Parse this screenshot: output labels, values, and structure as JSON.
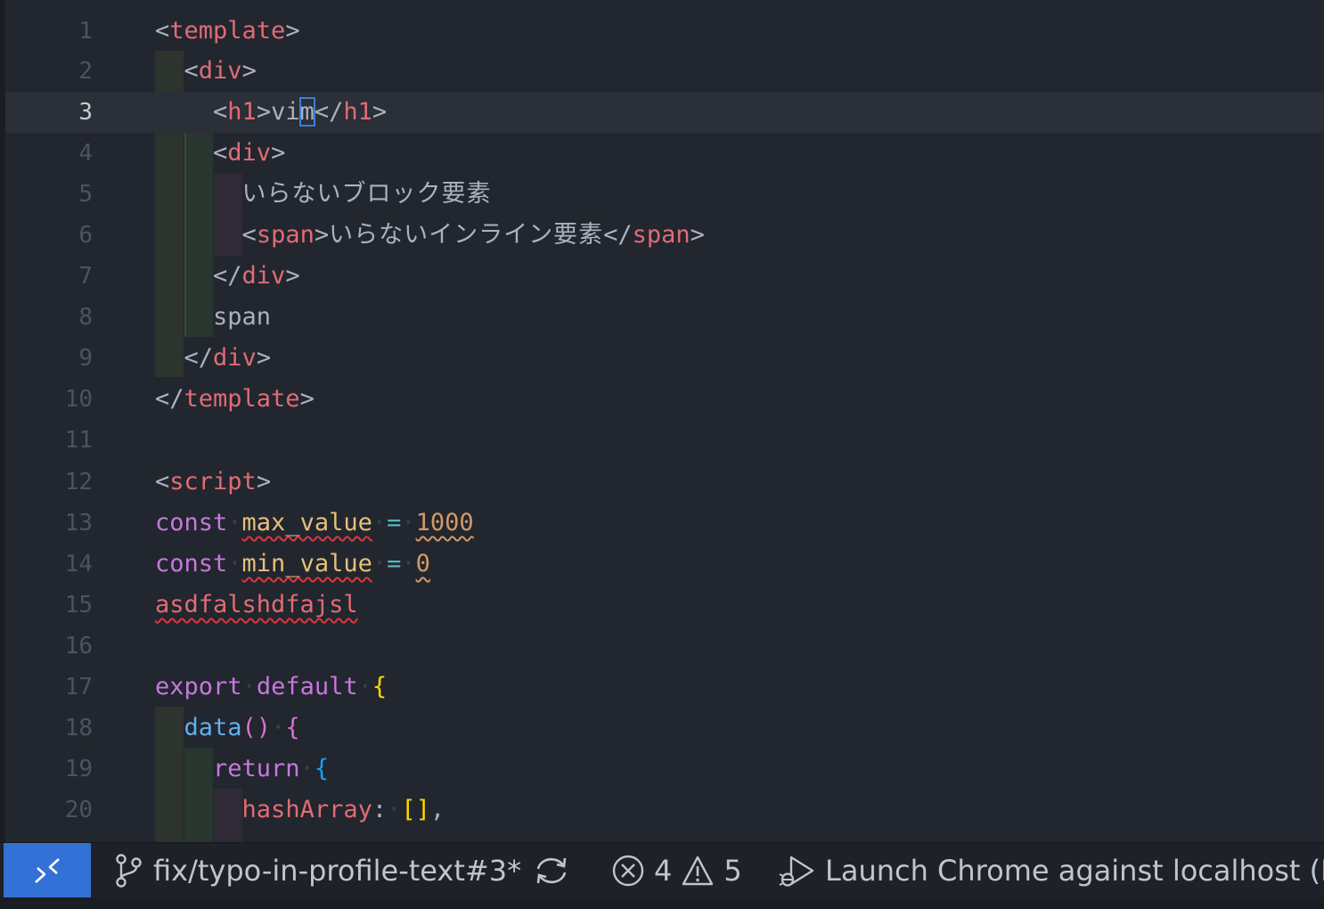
{
  "editor": {
    "active_line": 3,
    "lines": [
      {
        "num": "1"
      },
      {
        "num": "2"
      },
      {
        "num": "3"
      },
      {
        "num": "4"
      },
      {
        "num": "5"
      },
      {
        "num": "6"
      },
      {
        "num": "7"
      },
      {
        "num": "8"
      },
      {
        "num": "9"
      },
      {
        "num": "10"
      },
      {
        "num": "11"
      },
      {
        "num": "12"
      },
      {
        "num": "13"
      },
      {
        "num": "14"
      },
      {
        "num": "15"
      },
      {
        "num": "16"
      },
      {
        "num": "17"
      },
      {
        "num": "18"
      },
      {
        "num": "19"
      },
      {
        "num": "20"
      }
    ],
    "tokens": {
      "template": "template",
      "div": "div",
      "h1": "h1",
      "vim_a": "vi",
      "vim_b": "m",
      "jp_block": "いらないブロック要素",
      "span": "span",
      "jp_inline": "いらないインライン要素",
      "span_text": "span",
      "script": "script",
      "const": "const",
      "max_value": "max_value",
      "num_1000": "1000",
      "min_value": "min_value",
      "num_0": "0",
      "garbage": "asdfalshdfajsl",
      "export": "export",
      "default": "default",
      "data_fn": "data",
      "return": "return",
      "hashArray": "hashArray"
    }
  },
  "statusbar": {
    "branch": "fix/typo-in-profile-text#3*",
    "errors": "4",
    "warnings": "5",
    "launch": "Launch Chrome against localhost (Buil"
  },
  "colors": {
    "background": "#22262e",
    "remote_button": "#3471d6",
    "tag": "#e06c75",
    "keyword": "#c678dd",
    "variable": "#e5c07b",
    "number": "#d19a66",
    "function": "#61afef"
  }
}
